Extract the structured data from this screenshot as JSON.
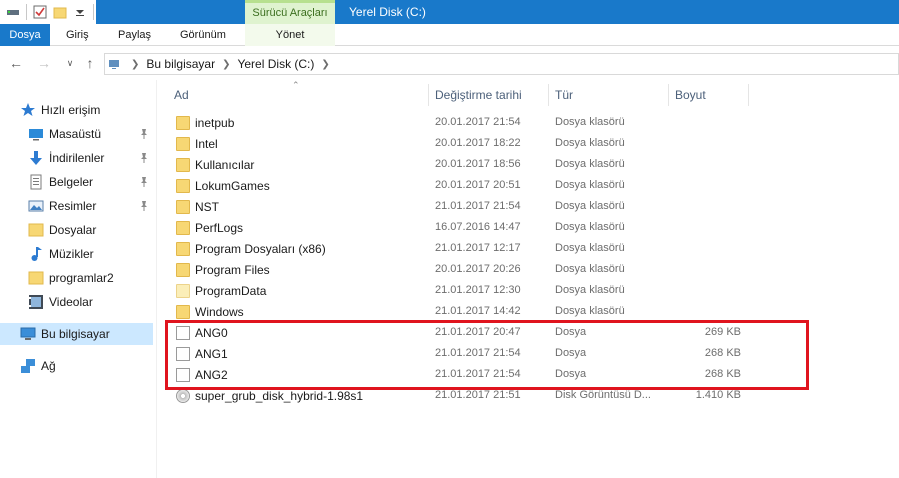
{
  "window": {
    "title": "Yerel Disk (C:)",
    "context_tab_header": "Sürücü Araçları"
  },
  "ribbon": {
    "tabs": [
      {
        "label": "Dosya"
      },
      {
        "label": "Giriş"
      },
      {
        "label": "Paylaş"
      },
      {
        "label": "Görünüm"
      },
      {
        "label": "Yönet"
      }
    ]
  },
  "address": {
    "crumbs": [
      "Bu bilgisayar",
      "Yerel Disk (C:)"
    ]
  },
  "sidebar": {
    "quick_access": "Hızlı erişim",
    "items": [
      {
        "label": "Masaüstü",
        "icon": "desktop-icon",
        "pinned": true
      },
      {
        "label": "İndirilenler",
        "icon": "download-icon",
        "pinned": true
      },
      {
        "label": "Belgeler",
        "icon": "documents-icon",
        "pinned": true
      },
      {
        "label": "Resimler",
        "icon": "pictures-icon",
        "pinned": true
      },
      {
        "label": "Dosyalar",
        "icon": "folder-icon",
        "pinned": false
      },
      {
        "label": "Müzikler",
        "icon": "music-icon",
        "pinned": false
      },
      {
        "label": "programlar2",
        "icon": "folder-icon",
        "pinned": false
      },
      {
        "label": "Videolar",
        "icon": "videos-icon",
        "pinned": false
      }
    ],
    "this_pc": "Bu bilgisayar",
    "network": "Ağ"
  },
  "columns": {
    "name": "Ad",
    "modified": "Değiştirme tarihi",
    "type": "Tür",
    "size": "Boyut"
  },
  "files": [
    {
      "name": "inetpub",
      "date": "20.01.2017 21:54",
      "type": "Dosya klasörü",
      "size": "",
      "icon": "folder-icon"
    },
    {
      "name": "Intel",
      "date": "20.01.2017 18:22",
      "type": "Dosya klasörü",
      "size": "",
      "icon": "folder-icon"
    },
    {
      "name": "Kullanıcılar",
      "date": "20.01.2017 18:56",
      "type": "Dosya klasörü",
      "size": "",
      "icon": "folder-icon"
    },
    {
      "name": "LokumGames",
      "date": "20.01.2017 20:51",
      "type": "Dosya klasörü",
      "size": "",
      "icon": "folder-icon"
    },
    {
      "name": "NST",
      "date": "21.01.2017 21:54",
      "type": "Dosya klasörü",
      "size": "",
      "icon": "folder-icon"
    },
    {
      "name": "PerfLogs",
      "date": "16.07.2016 14:47",
      "type": "Dosya klasörü",
      "size": "",
      "icon": "folder-icon"
    },
    {
      "name": "Program Dosyaları (x86)",
      "date": "21.01.2017 12:17",
      "type": "Dosya klasörü",
      "size": "",
      "icon": "folder-icon"
    },
    {
      "name": "Program Files",
      "date": "20.01.2017 20:26",
      "type": "Dosya klasörü",
      "size": "",
      "icon": "folder-icon"
    },
    {
      "name": "ProgramData",
      "date": "21.01.2017 12:30",
      "type": "Dosya klasörü",
      "size": "",
      "icon": "folder-icon"
    },
    {
      "name": "Windows",
      "date": "21.01.2017 14:42",
      "type": "Dosya klasörü",
      "size": "",
      "icon": "folder-icon"
    },
    {
      "name": "ANG0",
      "date": "21.01.2017 20:47",
      "type": "Dosya",
      "size": "269 KB",
      "icon": "file-icon"
    },
    {
      "name": "ANG1",
      "date": "21.01.2017 21:54",
      "type": "Dosya",
      "size": "268 KB",
      "icon": "file-icon"
    },
    {
      "name": "ANG2",
      "date": "21.01.2017 21:54",
      "type": "Dosya",
      "size": "268 KB",
      "icon": "file-icon"
    },
    {
      "name": "super_grub_disk_hybrid-1.98s1",
      "date": "21.01.2017 21:51",
      "type": "Disk Görüntüsü D...",
      "size": "1.410 KB",
      "icon": "disk-image-icon"
    }
  ],
  "colors": {
    "accent": "#1979ca",
    "highlight_box": "#e0141e",
    "selection": "#cce8ff"
  }
}
